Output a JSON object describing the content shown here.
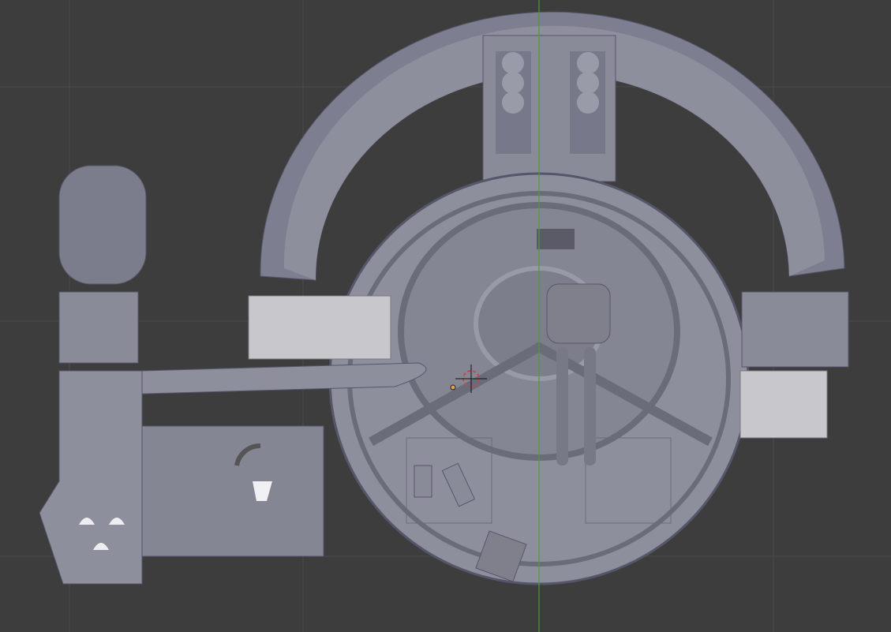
{
  "viewport": {
    "background_color": "#3d3d3d",
    "grid_color": "#4b4b4b",
    "y_axis_color": "#4f9a3a",
    "model_color": "#8e8f9c",
    "model_dark_color": "#6b6c7a",
    "model_light_color": "#a5a6b3",
    "edge_color": "#55566a"
  },
  "overlays": {
    "cursor_3d": {
      "icon": "3d-cursor-icon",
      "ring_color": "#c0474c"
    },
    "object_origin": {
      "icon": "origin-dot-icon",
      "color": "#e0a050"
    }
  }
}
